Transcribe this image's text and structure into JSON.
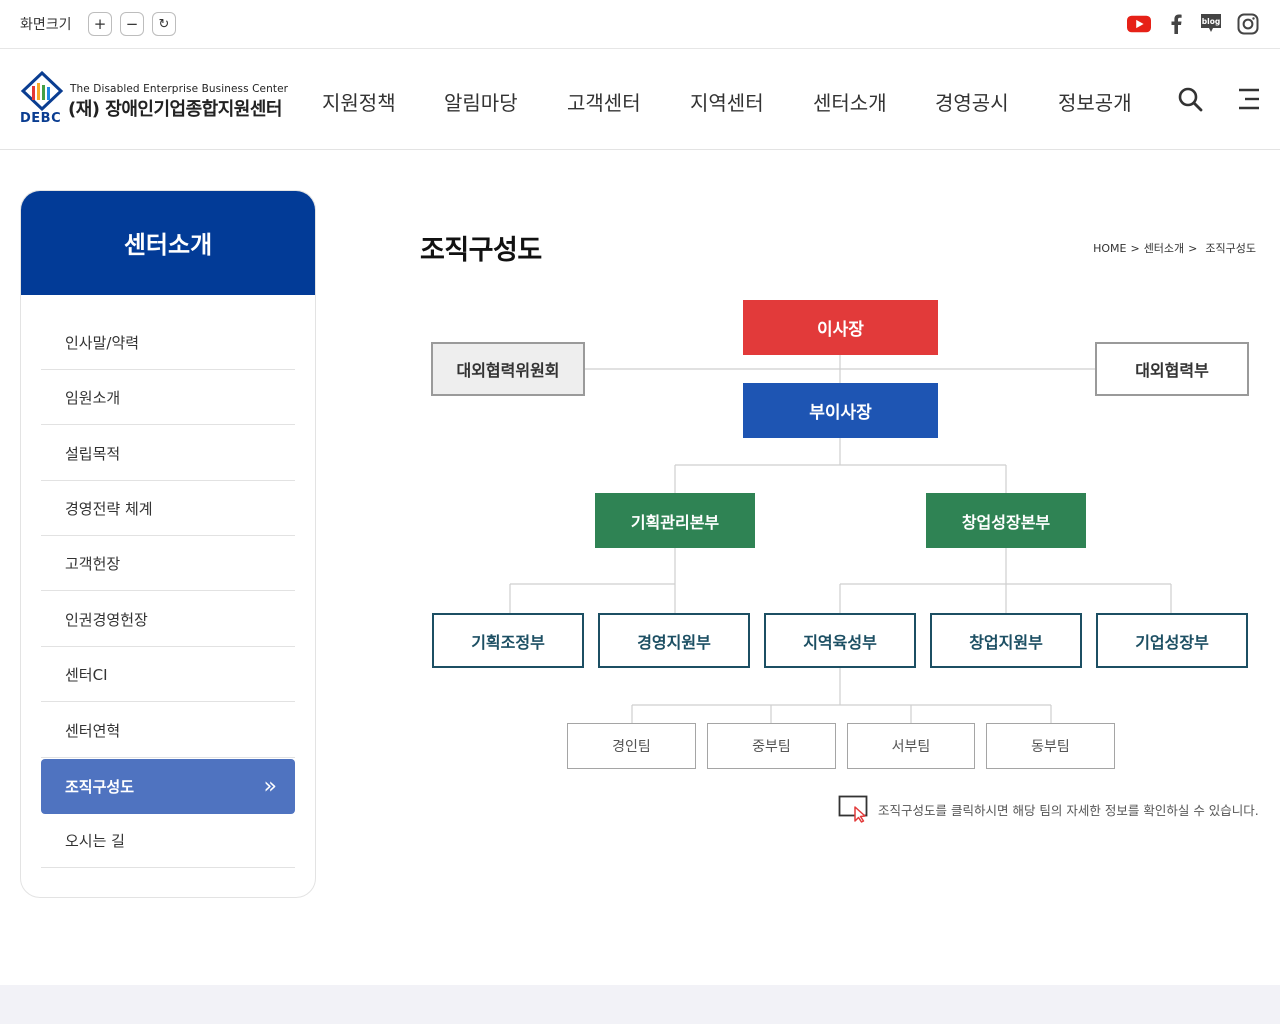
{
  "topbar": {
    "zoom_label": "화면크기",
    "zoom_in": "+",
    "zoom_out": "−",
    "zoom_reset": "↻",
    "social_icons": [
      "youtube-icon",
      "facebook-icon",
      "blog-icon",
      "instagram-icon"
    ],
    "blog_text": "blog"
  },
  "header": {
    "logo_en": "The Disabled Enterprise Business Center",
    "logo_ko": "(재) 장애인기업종합지원센터",
    "logo_abbr": "DEBC",
    "nav": [
      "지원정책",
      "알림마당",
      "고객센터",
      "지역센터",
      "센터소개",
      "경영공시",
      "정보공개"
    ],
    "icons": [
      "search-icon",
      "menu-icon"
    ]
  },
  "sidebar": {
    "title": "센터소개",
    "items": [
      {
        "label": "인사말/약력"
      },
      {
        "label": "임원소개"
      },
      {
        "label": "설립목적"
      },
      {
        "label": "경영전략 체계"
      },
      {
        "label": "고객헌장"
      },
      {
        "label": "인권경영헌장"
      },
      {
        "label": "센터CI"
      },
      {
        "label": "센터연혁"
      },
      {
        "label": "조직구성도",
        "active": true,
        "arrow": "»"
      },
      {
        "label": "오시는 길"
      }
    ]
  },
  "content": {
    "title": "조직구성도",
    "breadcrumb": [
      "HOME",
      ">",
      "센터소개",
      ">",
      "조직구성도"
    ]
  },
  "org_chart": {
    "chairman": "이사장",
    "vice_chairman": "부이사장",
    "committee": "대외협력위원회",
    "external_dept": "대외협력부",
    "divisions": [
      "기획관리본부",
      "창업성장본부"
    ],
    "departments": [
      "기획조정부",
      "경영지원부",
      "지역육성부",
      "창업지원부",
      "기업성장부"
    ],
    "teams": [
      "경인팀",
      "중부팀",
      "서부팀",
      "동부팀"
    ]
  },
  "note": "조직구성도를 클릭하시면 해당 팀의 자세한 정보를 확인하실 수 있습니다.",
  "colors": {
    "brand_blue": "#023b97",
    "active_item": "#4f73c0",
    "chairman_red": "#e23a3a",
    "vice_blue": "#1e55b3",
    "division_green": "#2f8354",
    "dept_border": "#1c4f63"
  }
}
